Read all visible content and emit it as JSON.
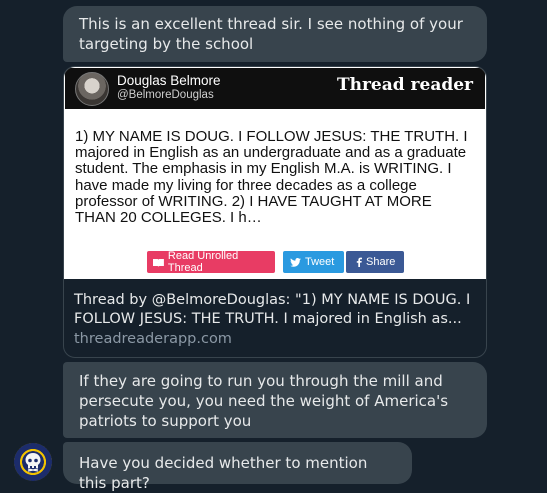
{
  "messages": [
    {
      "text": "This is an excellent thread sir. I see nothing of your targeting by the school"
    },
    {
      "text": "If they are going to run you through the mill and persecute you, you need the weight of America's patriots to support you"
    },
    {
      "text": "Have you decided whether to mention this part?"
    }
  ],
  "link_card": {
    "author_name": "Douglas Belmore",
    "author_handle": "@BelmoreDouglas",
    "brand": "Thread reader",
    "preview_text": "1) MY NAME IS DOUG. I FOLLOW JESUS: THE TRUTH. I majored in English as an undergraduate and as a graduate student. The emphasis in my English M.A. is WRITING. I have made my living for three decades as a college professor of WRITING. 2) I HAVE TAUGHT AT MORE THAN 20 COLLEGES. I h…",
    "buttons": {
      "unroll": "Read Unrolled Thread",
      "tweet": "Tweet",
      "share": "Share"
    },
    "meta_title": "Thread by @BelmoreDouglas: \"1) MY NAME IS DOUG. I FOLLOW JESUS: THE TRUTH. I majored in English as...",
    "domain": "threadreaderapp.com"
  },
  "colors": {
    "background": "#15202b",
    "bubble": "#38444d",
    "unroll": "#e83c64",
    "tweet": "#2a9ae0",
    "share": "#3b5995"
  },
  "icons": {
    "avatar": "sender-avatar-badge",
    "unroll": "book-icon",
    "tweet": "twitter-bird-icon",
    "share": "facebook-icon"
  }
}
